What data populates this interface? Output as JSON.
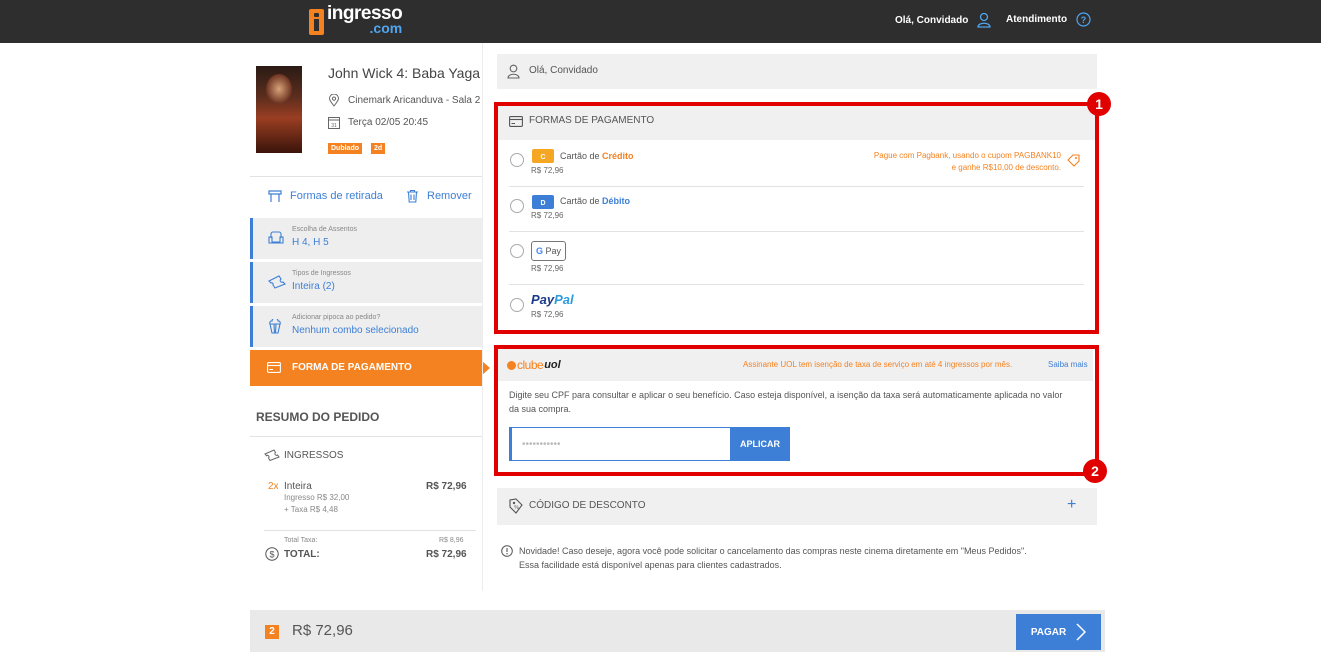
{
  "header": {
    "logo_top": "ingresso",
    "logo_bottom": ".com",
    "user_label": "Olá, Convidado",
    "support_label": "Atendimento"
  },
  "movie": {
    "title": "John Wick 4: Baba Yaga",
    "cinema": "Cinemark Aricanduva - Sala 2",
    "datetime": "Terça 02/05 20:45",
    "calendar_day": "31",
    "tags": [
      "Dublado",
      "2d"
    ]
  },
  "actions": {
    "pickup": "Formas de retirada",
    "remove": "Remover"
  },
  "steps": [
    {
      "label": "Escolha de Assentos",
      "value": "H 4, H 5"
    },
    {
      "label": "Tipos de Ingressos",
      "value": "Inteira (2)"
    },
    {
      "label": "Adicionar pipoca ao pedido?",
      "value": "Nenhum combo selecionado"
    }
  ],
  "active_step": "FORMA DE PAGAMENTO",
  "summary": {
    "title": "RESUMO DO PEDIDO",
    "section": "INGRESSOS",
    "qty": "2x",
    "item": "Inteira",
    "item_price": "R$ 72,96",
    "ingresso_line": "Ingresso R$ 32,00",
    "taxa_line": "+ Taxa R$ 4,48",
    "total_taxa_label": "Total Taxa:",
    "total_taxa_value": "R$ 8,96",
    "total_label": "TOTAL:",
    "total_value": "R$ 72,96"
  },
  "greeting": "Olá, Convidado",
  "payment": {
    "header": "FORMAS DE PAGAMENTO",
    "methods": [
      {
        "prefix": "Cartão de ",
        "highlight": "Crédito",
        "price": "R$ 72,96",
        "icon_letter": "C"
      },
      {
        "prefix": "Cartão de ",
        "highlight": "Débito",
        "price": "R$ 72,96",
        "icon_letter": "D"
      },
      {
        "prefix": "",
        "highlight": "",
        "price": "R$ 72,96",
        "icon_text": "G Pay"
      },
      {
        "prefix": "",
        "highlight": "",
        "price": "R$ 72,96",
        "icon_text": "PayPal"
      }
    ],
    "promo_line1": "Pague com Pagbank, usando o cupom PAGBANK10",
    "promo_line2": "e ganhe R$10,00 de desconto."
  },
  "annotations": [
    "1",
    "2"
  ],
  "uol": {
    "brand_clube": "clube",
    "brand_uol": "uol",
    "note": "Assinante UOL tem isenção de taxa de serviço em até 4 ingressos por mês.",
    "more": "Saiba mais",
    "description": "Digite seu CPF para consultar e aplicar o seu benefício. Caso esteja disponível, a isenção da taxa será automaticamente aplicada no valor da sua compra.",
    "input_value": "•••••••••••",
    "apply": "APLICAR"
  },
  "discount": {
    "label": "CÓDIGO DE DESCONTO",
    "plus": "+"
  },
  "notice": {
    "line1": "Novidade! Caso deseje, agora você pode solicitar o cancelamento das compras neste cinema diretamente em \"Meus Pedidos\".",
    "line2": "Essa facilidade está disponível apenas para clientes cadastrados."
  },
  "footer": {
    "count": "2",
    "total": "R$ 72,96",
    "pay": "PAGAR"
  },
  "colors": {
    "accent": "#f58220",
    "primary": "#3d7fd6",
    "topbar": "#2e2e2e",
    "highlight_box": "#e00000"
  }
}
